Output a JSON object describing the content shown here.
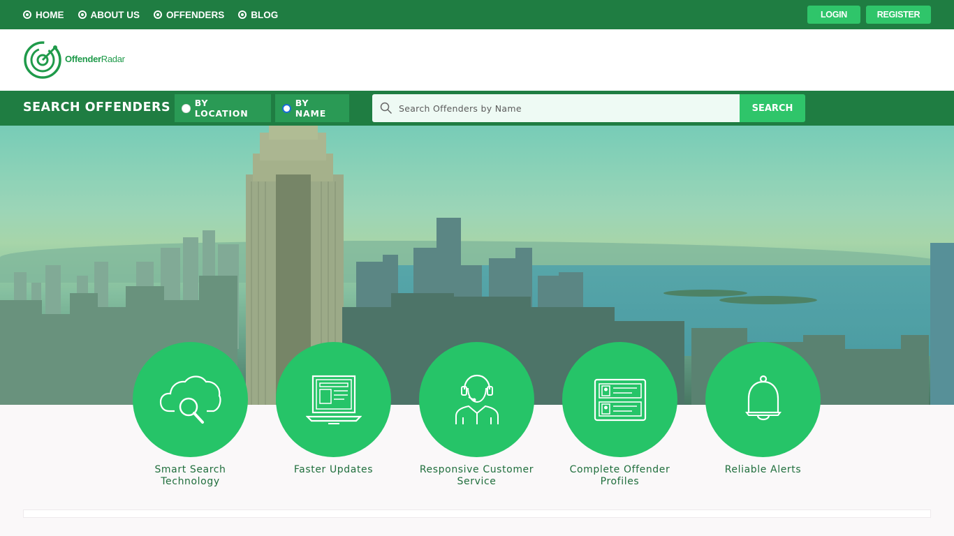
{
  "nav": {
    "items": [
      {
        "label": "HOME"
      },
      {
        "label": "ABOUT US"
      },
      {
        "label": "OFFENDERS"
      },
      {
        "label": "BLOG"
      }
    ],
    "login_label": "LOGIN",
    "register_label": "REGISTER"
  },
  "logo": {
    "bold": "Offender",
    "light": "Radar"
  },
  "search": {
    "title": "SEARCH OFFENDERS",
    "by_location_label": "BY LOCATION",
    "by_name_label": "BY NAME",
    "selected_mode": "BY NAME",
    "placeholder": "Search Offenders by Name",
    "value": "",
    "button_label": "SEARCH"
  },
  "features": [
    {
      "line1": "Smart Search",
      "line2": "Technology",
      "icon": "cloud-search-icon"
    },
    {
      "line1": "Faster Updates",
      "line2": "",
      "icon": "laptop-icon"
    },
    {
      "line1": "Responsive Customer",
      "line2": "Service",
      "icon": "headset-agent-icon"
    },
    {
      "line1": "Complete Offender",
      "line2": "Profiles",
      "icon": "profile-cards-icon"
    },
    {
      "line1": "Reliable Alerts",
      "line2": "",
      "icon": "bell-icon"
    }
  ],
  "colors": {
    "dark_green": "#1f7d42",
    "accent_green": "#2fc56a",
    "circle_green": "#26c468",
    "label_green": "#1f6e3c"
  }
}
